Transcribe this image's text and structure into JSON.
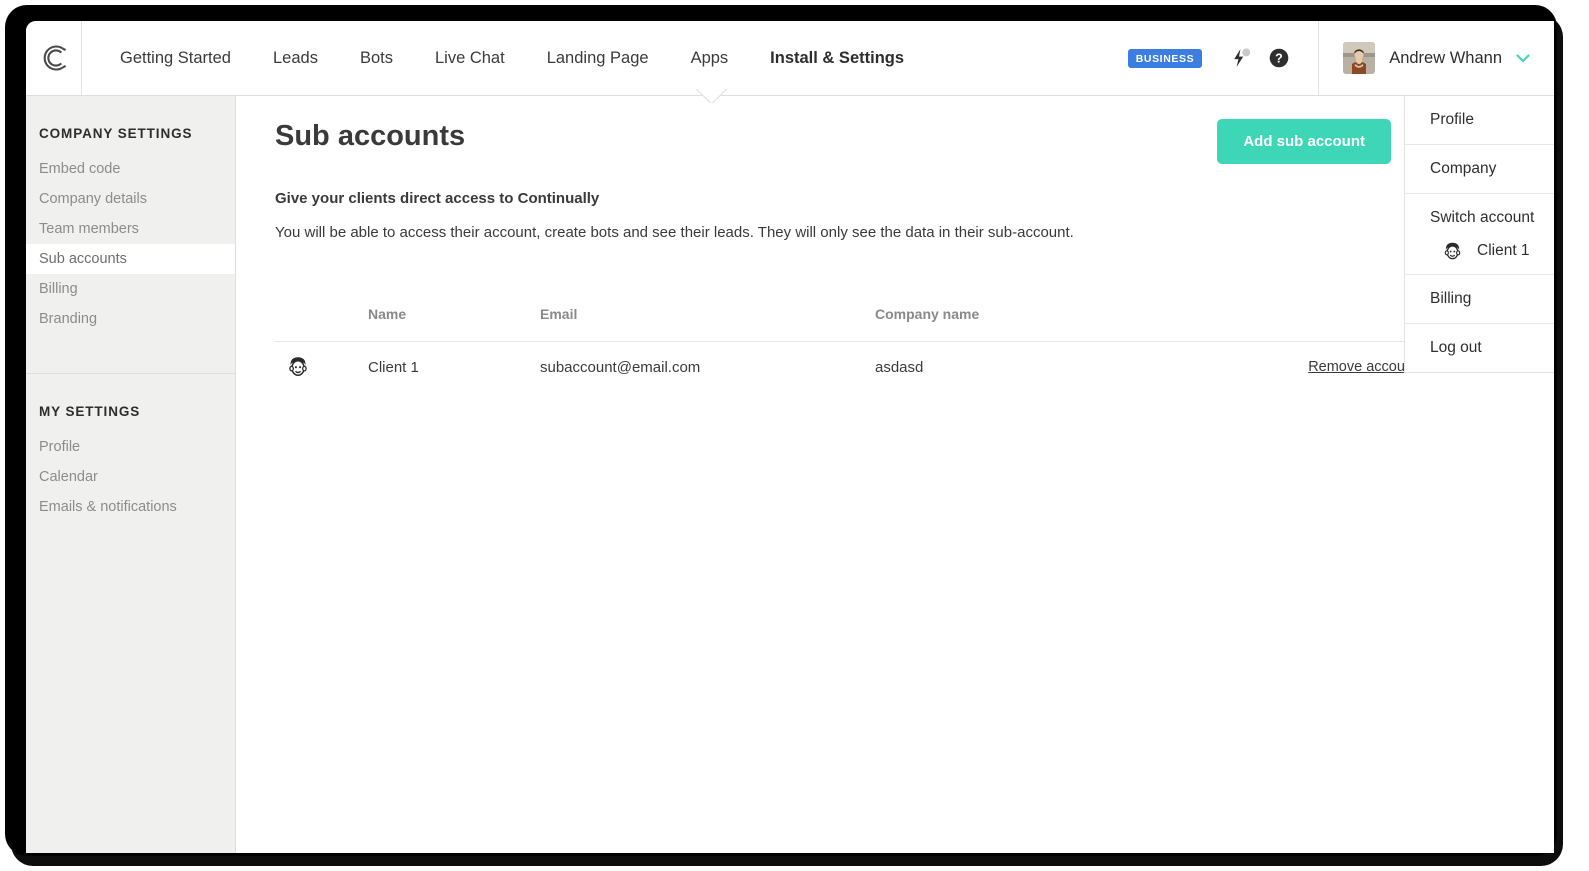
{
  "header": {
    "logo_icon": "continually-c-logo",
    "nav": [
      {
        "label": "Getting Started",
        "active": false
      },
      {
        "label": "Leads",
        "active": false
      },
      {
        "label": "Bots",
        "active": false
      },
      {
        "label": "Live Chat",
        "active": false
      },
      {
        "label": "Landing Page",
        "active": false
      },
      {
        "label": "Apps",
        "active": false
      },
      {
        "label": "Install & Settings",
        "active": true
      }
    ],
    "plan_badge": "BUSINESS",
    "plan_badge_color": "#3b7de0",
    "bolt_icon": "lightning-bolt-icon",
    "help_icon": "help-circle-icon",
    "user_name": "Andrew Whann",
    "user_caret_icon": "chevron-down-icon",
    "avatar_icon": "user-avatar-photo"
  },
  "sidebar": {
    "sections": [
      {
        "title": "COMPANY SETTINGS",
        "items": [
          {
            "label": "Embed code",
            "active": false
          },
          {
            "label": "Company details",
            "active": false
          },
          {
            "label": "Team members",
            "active": false
          },
          {
            "label": "Sub accounts",
            "active": true
          },
          {
            "label": "Billing",
            "active": false
          },
          {
            "label": "Branding",
            "active": false
          }
        ]
      },
      {
        "title": "MY SETTINGS",
        "items": [
          {
            "label": "Profile",
            "active": false
          },
          {
            "label": "Calendar",
            "active": false
          },
          {
            "label": "Emails & notifications",
            "active": false
          }
        ]
      }
    ]
  },
  "main": {
    "page_title": "Sub accounts",
    "add_button": "Add sub account",
    "add_button_color": "#3dd6b6",
    "lead_heading": "Give your clients direct access to Continually",
    "lead_body": "You will be able to access their account, create bots and see their leads. They will only see the data in their sub-account.",
    "table": {
      "columns": [
        "Name",
        "Email",
        "Company name"
      ],
      "rows": [
        {
          "avatar_icon": "client-face-avatar",
          "name": "Client 1",
          "email": "subaccount@email.com",
          "company": "asdasd",
          "action": "Remove account"
        }
      ]
    }
  },
  "dropdown": {
    "items": [
      {
        "label": "Profile"
      },
      {
        "label": "Company"
      }
    ],
    "switch_group": {
      "label": "Switch account",
      "accounts": [
        {
          "name": "Client 1",
          "avatar_icon": "client-face-avatar"
        }
      ]
    },
    "items_after": [
      {
        "label": "Billing"
      },
      {
        "label": "Log out"
      }
    ]
  }
}
